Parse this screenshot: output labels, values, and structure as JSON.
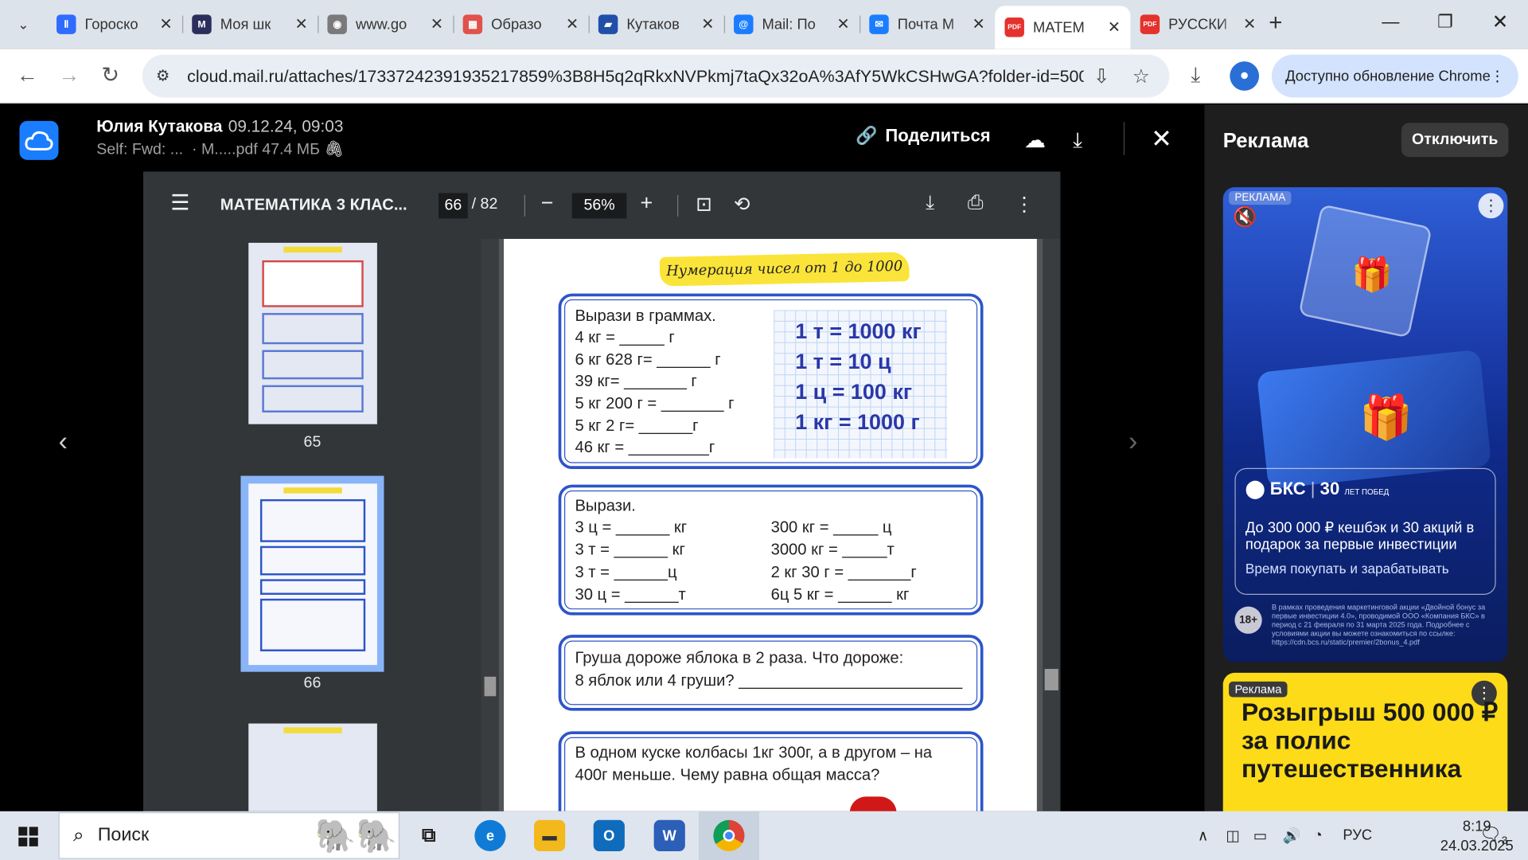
{
  "browser": {
    "tabs": [
      {
        "title": "Гороско",
        "favicon_color": "#2f6bff",
        "favicon_glyph": "Ⅱ",
        "active": false
      },
      {
        "title": "Моя шк",
        "favicon_color": "#2b2d5c",
        "favicon_glyph": "M",
        "active": false
      },
      {
        "title": "www.go",
        "favicon_color": "#7a7a7a",
        "favicon_glyph": "◉",
        "active": false
      },
      {
        "title": "Образо",
        "favicon_color": "#e0524b",
        "favicon_glyph": "▦",
        "active": false
      },
      {
        "title": "Кутаков",
        "favicon_color": "#1f4fa8",
        "favicon_glyph": "▰",
        "active": false
      },
      {
        "title": "Mail: По",
        "favicon_color": "#1a7dff",
        "favicon_glyph": "@",
        "active": false
      },
      {
        "title": "Почта М",
        "favicon_color": "#1a7dff",
        "favicon_glyph": "✉",
        "active": false
      },
      {
        "title": "МАТЕМ",
        "favicon_color": "#e5322d",
        "favicon_glyph": "PDF",
        "active": true
      },
      {
        "title": "РУССКИ",
        "favicon_color": "#e5322d",
        "favicon_glyph": "PDF",
        "active": false
      }
    ],
    "url": "cloud.mail.ru/attaches/17337242391935217859%3B8H5q2qRkxNVPkmj7taQx32oA%3AfY5WkCSHwGA?folder-id=5000...",
    "update_label": "Доступно обновление Chrome"
  },
  "viewer": {
    "sender": "Юлия Кутакова",
    "date": "09.12.24, 09:03",
    "subject": "Self: Fwd: ...",
    "file": "· М.....pdf",
    "size": "47.4 МБ",
    "share_label": "Поделиться"
  },
  "pdf": {
    "title": "МАТЕМАТИКА 3 КЛАС...",
    "page": "66",
    "page_total": "/ 82",
    "zoom": "56%",
    "thumb_labels": [
      "65",
      "66"
    ]
  },
  "page": {
    "header": "Нумерация чисел от 1 до 1000",
    "box1": {
      "lines": [
        "Вырази в граммах.",
        "4 кг = _____ г",
        "6 кг 628 г= ______ г",
        "39 кг= _______ г",
        "5 кг 200 г = _______ г",
        "5 кг 2 г= ______г",
        "46 кг = _________г"
      ],
      "facts": [
        "1 т = 1000 кг",
        "1 т = 10 ц",
        "1 ц = 100 кг",
        "1 кг = 1000 г"
      ]
    },
    "box2": {
      "title": "Вырази.",
      "left": [
        "3 ц = ______ кг",
        "3 т = ______ кг",
        "3 т = ______ц",
        "30 ц = ______т"
      ],
      "right": [
        "300 кг = _____ ц",
        "3000 кг = _____т",
        "2 кг 30 г = _______г",
        "6ц 5 кг = ______ кг"
      ]
    },
    "box3": [
      "Груша дороже яблока в 2 раза. Что дороже:",
      "8 яблок или 4 груши? _________________________"
    ],
    "box4": [
      "В одном куске колбасы 1кг 300г, а в другом – на",
      "400г меньше. Чему равна общая масса?"
    ]
  },
  "ads": {
    "header": "Реклама",
    "off_label": "Отключить",
    "ad1": {
      "tag": "РЕКЛАМА",
      "brand": "БКС",
      "years": "30",
      "years_note": "ЛЕТ ПОБЕД",
      "headline": "До 300 000 ₽ кешбэк и 30 акций в подарок  за первые инвестиции",
      "cta": "Время покупать и зарабатывать",
      "age": "18+",
      "fine": "В рамках проведения маркетинговой акции «Двойной бонус за первые инвестиции 4.0», проводимой ООО «Компания БКС» в период с 21 февраля по 31 марта 2025 года. Подробнее с условиями акции вы можете ознакомиться по ссылке: https://cdn.bcs.ru/static/premier/2bonus_4.pdf"
    },
    "ad2": {
      "tag": "Реклама",
      "headline": "Розыгрыш 500 000 ₽ за полис путешественника"
    }
  },
  "taskbar": {
    "search_label": "Поиск",
    "lang": "РУС",
    "time": "8:19",
    "date": "24.03.2025",
    "notifications": "3"
  }
}
